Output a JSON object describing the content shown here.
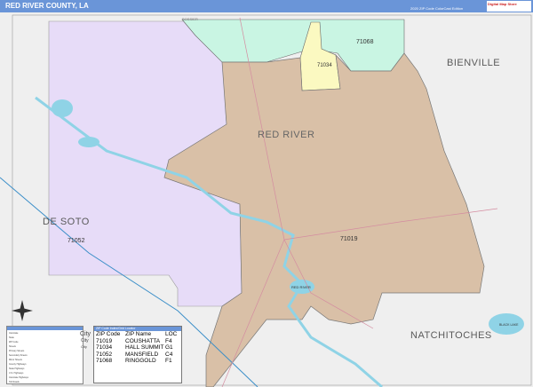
{
  "header": {
    "title": "RED RIVER COUNTY, LA",
    "edition": "2020 ZIP Code ColorCast Edition",
    "logo": "Digital Map Store"
  },
  "colors": {
    "header": "#6a95d8",
    "red_river_county": "#d9c0a7",
    "de_soto_zip": "#e7dcf8",
    "zip_71068": "#c9f5e3",
    "zip_71034": "#fbf9c1",
    "outside": "#efefef",
    "water": "#8fd3e6"
  },
  "labels": {
    "bienville": "BIENVILLE",
    "red_river": "RED RIVER",
    "de_soto": "DE SOTO",
    "natchitoches": "NATCHITOCHES",
    "bossier": "BOSSIER",
    "red_river_water": "RED RIVER",
    "black_lake": "BLACK LAKE"
  },
  "zip_labels": [
    "71068",
    "71034",
    "71052",
    "71019"
  ],
  "zip_table": {
    "title": "ZIP Code Index/Grid Locator",
    "headers": [
      "ZIP Code",
      "ZIP Name",
      "LOC"
    ],
    "rows": [
      [
        "71019",
        "COUSHATTA",
        "F4"
      ],
      [
        "71034",
        "HALL SUMMIT",
        "G1"
      ],
      [
        "71052",
        "MANSFIELD",
        "C4"
      ],
      [
        "71068",
        "RINGGOLD",
        "F1"
      ]
    ]
  },
  "legend": {
    "items": [
      "Interstate",
      "State",
      "ZIP Code",
      "Streets",
      "Primary Streets",
      "Secondary Streets",
      "Minor Streets",
      "County Highways",
      "State Highways",
      "U.S. Highways",
      "Interstate Highways",
      "Toll Roads"
    ],
    "city_sizes": [
      "City",
      "City",
      "City"
    ]
  }
}
